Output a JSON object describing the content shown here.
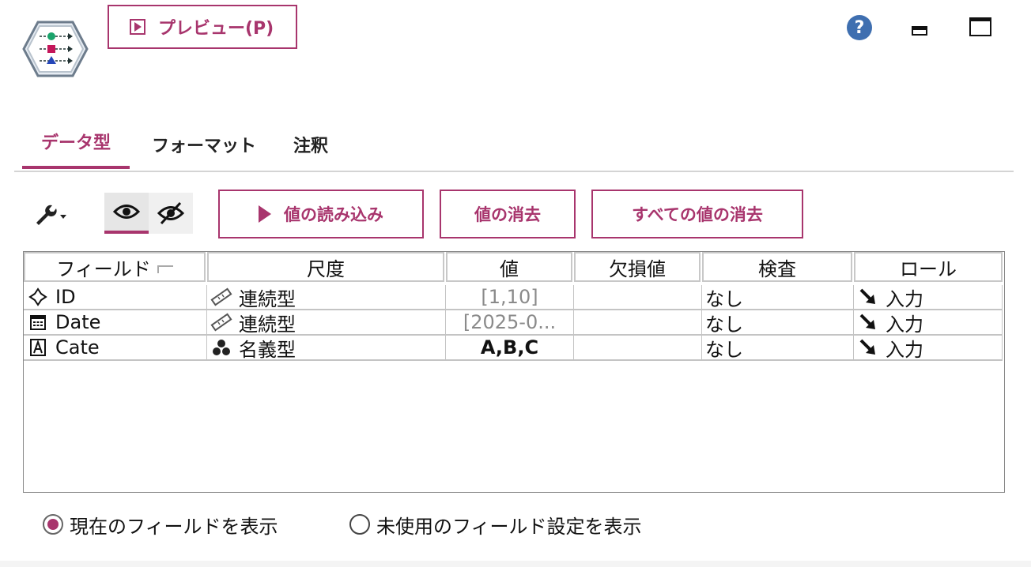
{
  "header": {
    "node_icon": "type-node-icon",
    "preview_label": "プレビュー(P)",
    "help_symbol": "?"
  },
  "tabs": [
    {
      "label": "データ型",
      "active": true
    },
    {
      "label": "フォーマット",
      "active": false
    },
    {
      "label": "注釈",
      "active": false
    }
  ],
  "toolbar": {
    "read_values_label": "値の読み込み",
    "clear_values_label": "値の消去",
    "clear_all_values_label": "すべての値の消去"
  },
  "table": {
    "columns": [
      "フィールド",
      "尺度",
      "値",
      "欠損値",
      "検査",
      "ロール"
    ],
    "rows": [
      {
        "field": "ID",
        "field_icon": "continuous-diamond-icon",
        "measure": "連続型",
        "measure_icon": "ruler-icon",
        "values": "[1,10]",
        "missing": "",
        "check": "なし",
        "role": "入力",
        "role_icon": "input-arrow-icon"
      },
      {
        "field": "Date",
        "field_icon": "calendar-icon",
        "measure": "連続型",
        "measure_icon": "ruler-icon",
        "values": "[2025-0...",
        "missing": "",
        "check": "なし",
        "role": "入力",
        "role_icon": "input-arrow-icon"
      },
      {
        "field": "Cate",
        "field_icon": "string-a-icon",
        "measure": "名義型",
        "measure_icon": "nominal-circles-icon",
        "values": "A,B,C",
        "missing": "",
        "check": "なし",
        "role": "入力",
        "role_icon": "input-arrow-icon"
      }
    ]
  },
  "view_options": {
    "current_label": "現在のフィールドを表示",
    "unused_label": "未使用のフィールド設定を表示",
    "selected": "current"
  },
  "colors": {
    "accent": "#a8356d",
    "help": "#3f6fb0"
  }
}
